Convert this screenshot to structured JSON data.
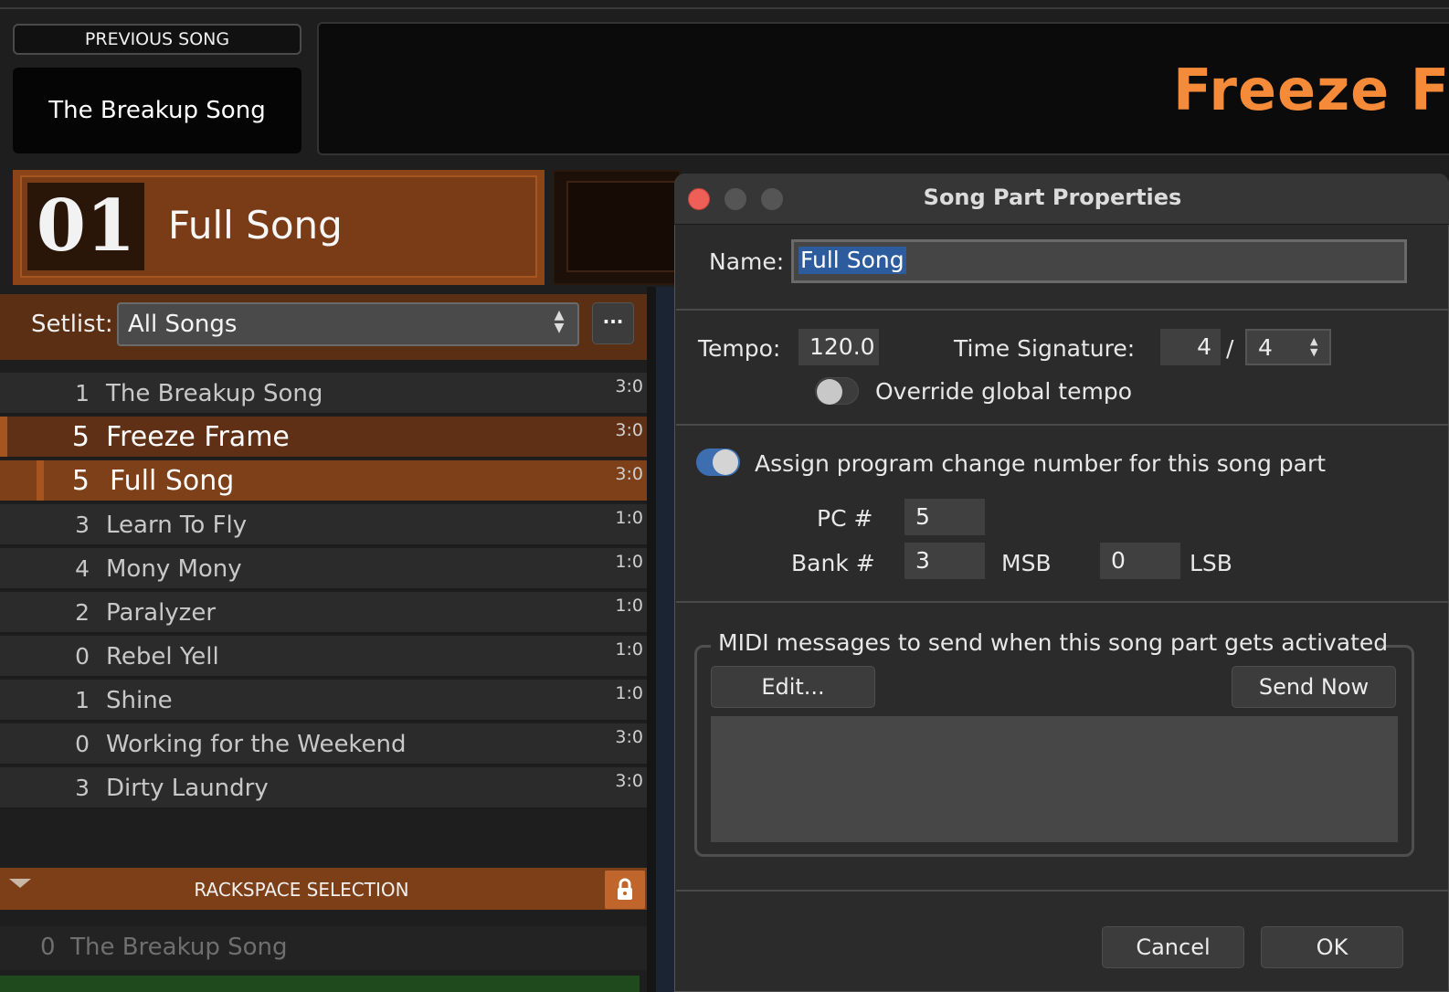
{
  "header": {
    "previous_label": "PREVIOUS SONG",
    "previous_song": "The Breakup Song",
    "current_song": "Freeze Fra"
  },
  "part": {
    "number": "01",
    "name": "Full Song"
  },
  "setlist": {
    "label": "Setlist:",
    "value": "All Songs",
    "more": "···"
  },
  "songs": [
    {
      "num": "1",
      "name": "The Breakup Song",
      "time": "3:0"
    },
    {
      "num": "5",
      "name": "Freeze Frame",
      "time": "3:0"
    },
    {
      "num": "5",
      "name": "Full Song",
      "time": "3:0"
    },
    {
      "num": "3",
      "name": "Learn To Fly",
      "time": "1:0"
    },
    {
      "num": "4",
      "name": "Mony Mony",
      "time": "1:0"
    },
    {
      "num": "2",
      "name": "Paralyzer",
      "time": "1:0"
    },
    {
      "num": "0",
      "name": "Rebel Yell",
      "time": "1:0"
    },
    {
      "num": "1",
      "name": "Shine",
      "time": "1:0"
    },
    {
      "num": "0",
      "name": "Working for the Weekend",
      "time": "3:0"
    },
    {
      "num": "3",
      "name": "Dirty Laundry",
      "time": "3:0"
    }
  ],
  "rackspace": {
    "title": "RACKSPACE SELECTION",
    "item_num": "0",
    "item_name": "The Breakup Song"
  },
  "dialog": {
    "title": "Song Part Properties",
    "name_label": "Name:",
    "name_value": "Full Song",
    "tempo_label": "Tempo:",
    "tempo_value": "120.0",
    "timesig_label": "Time Signature:",
    "timesig_num": "4",
    "timesig_slash": "/",
    "timesig_den": "4",
    "override_label": "Override global tempo",
    "override_on": false,
    "assign_label": "Assign program change number for this song part",
    "assign_on": true,
    "pc_label": "PC #",
    "pc_value": "5",
    "bank_label": "Bank #",
    "msb_value": "3",
    "msb_label": "MSB",
    "lsb_value": "0",
    "lsb_label": "LSB",
    "midi_group_label": "MIDI messages to send when this song part gets activated",
    "edit_button": "Edit...",
    "send_now_button": "Send Now",
    "cancel_button": "Cancel",
    "ok_button": "OK"
  },
  "colors": {
    "accent_orange": "#f58a38",
    "selection_blue": "#2c5b9e",
    "toggle_on": "#3d6fb0",
    "close_red": "#ed5f57"
  }
}
